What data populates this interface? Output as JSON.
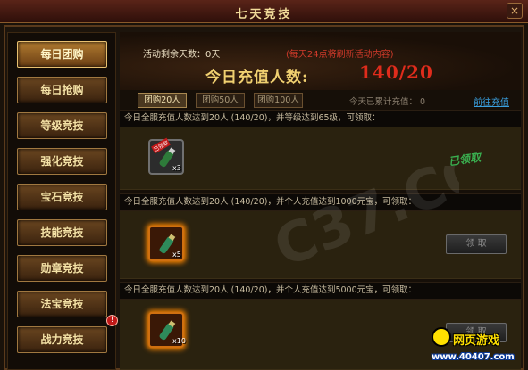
{
  "window": {
    "title": "七天竞技",
    "close_label": "×"
  },
  "sidebar": {
    "items": [
      {
        "label": "每日团购",
        "active": true
      },
      {
        "label": "每日抢购",
        "active": false
      },
      {
        "label": "等级竞技",
        "active": false
      },
      {
        "label": "强化竞技",
        "active": false
      },
      {
        "label": "宝石竞技",
        "active": false
      },
      {
        "label": "技能竞技",
        "active": false
      },
      {
        "label": "勋章竞技",
        "active": false
      },
      {
        "label": "法宝竞技",
        "active": false
      },
      {
        "label": "战力竞技",
        "active": false
      }
    ],
    "badge": "!"
  },
  "header": {
    "days_left": "活动剩余天数：0天",
    "refresh_note": "(每天24点将刷新活动内容)",
    "today_label": "今日充值人数:",
    "today_value": "140/20"
  },
  "tabs": [
    {
      "label": "团购20人",
      "active": true
    },
    {
      "label": "团购50人",
      "active": false
    },
    {
      "label": "团购100人",
      "active": false
    }
  ],
  "today_total": "今天已累计充值：  0",
  "recharge_link": "前往充值",
  "rewards": [
    {
      "condition": "今日全服充值人数达到20人 (140/20)，并等级达到65级，可领取：",
      "quantity": "x3",
      "status": "已领取",
      "item_tag": "已领取"
    },
    {
      "condition": "今日全服充值人数达到20人 (140/20)，并个人充值达到1000元宝，可领取：",
      "quantity": "x5",
      "button": "领 取"
    },
    {
      "condition": "今日全服充值人数达到20人 (140/20)，并个人充值达到5000元宝，可领取：",
      "quantity": "x10",
      "button": "领 取"
    }
  ],
  "watermark": "C37.COM",
  "logo": {
    "text": "网页游戏",
    "url": "www.40407.com"
  },
  "colors": {
    "accent_gold": "#f0d070",
    "count_red": "#e02c1c",
    "claimed_green": "#3ab050",
    "link_blue": "#3aa0e0"
  }
}
